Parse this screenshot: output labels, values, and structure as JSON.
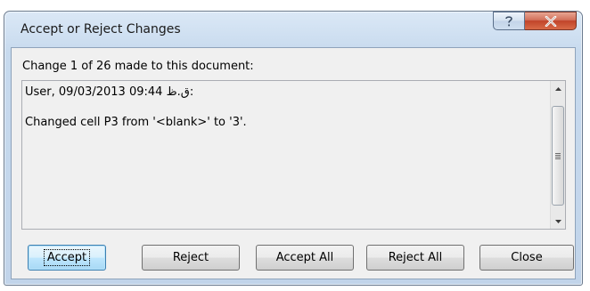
{
  "window": {
    "title": "Accept or Reject Changes",
    "help_glyph": "?",
    "close_glyph": "X"
  },
  "dialog": {
    "change_label": "Change 1 of 26 made to this document:",
    "change_details": {
      "line1": "User, 09/03/2013 09:44 ق.ظ:",
      "line2": "Changed cell P3 from '<blank>' to '3'."
    }
  },
  "buttons": {
    "accept": "Accept",
    "reject": "Reject",
    "accept_all": "Accept All",
    "reject_all": "Reject All",
    "close": "Close"
  },
  "colors": {
    "close_button": "#c1442a",
    "default_button_border": "#3c7fb1"
  }
}
